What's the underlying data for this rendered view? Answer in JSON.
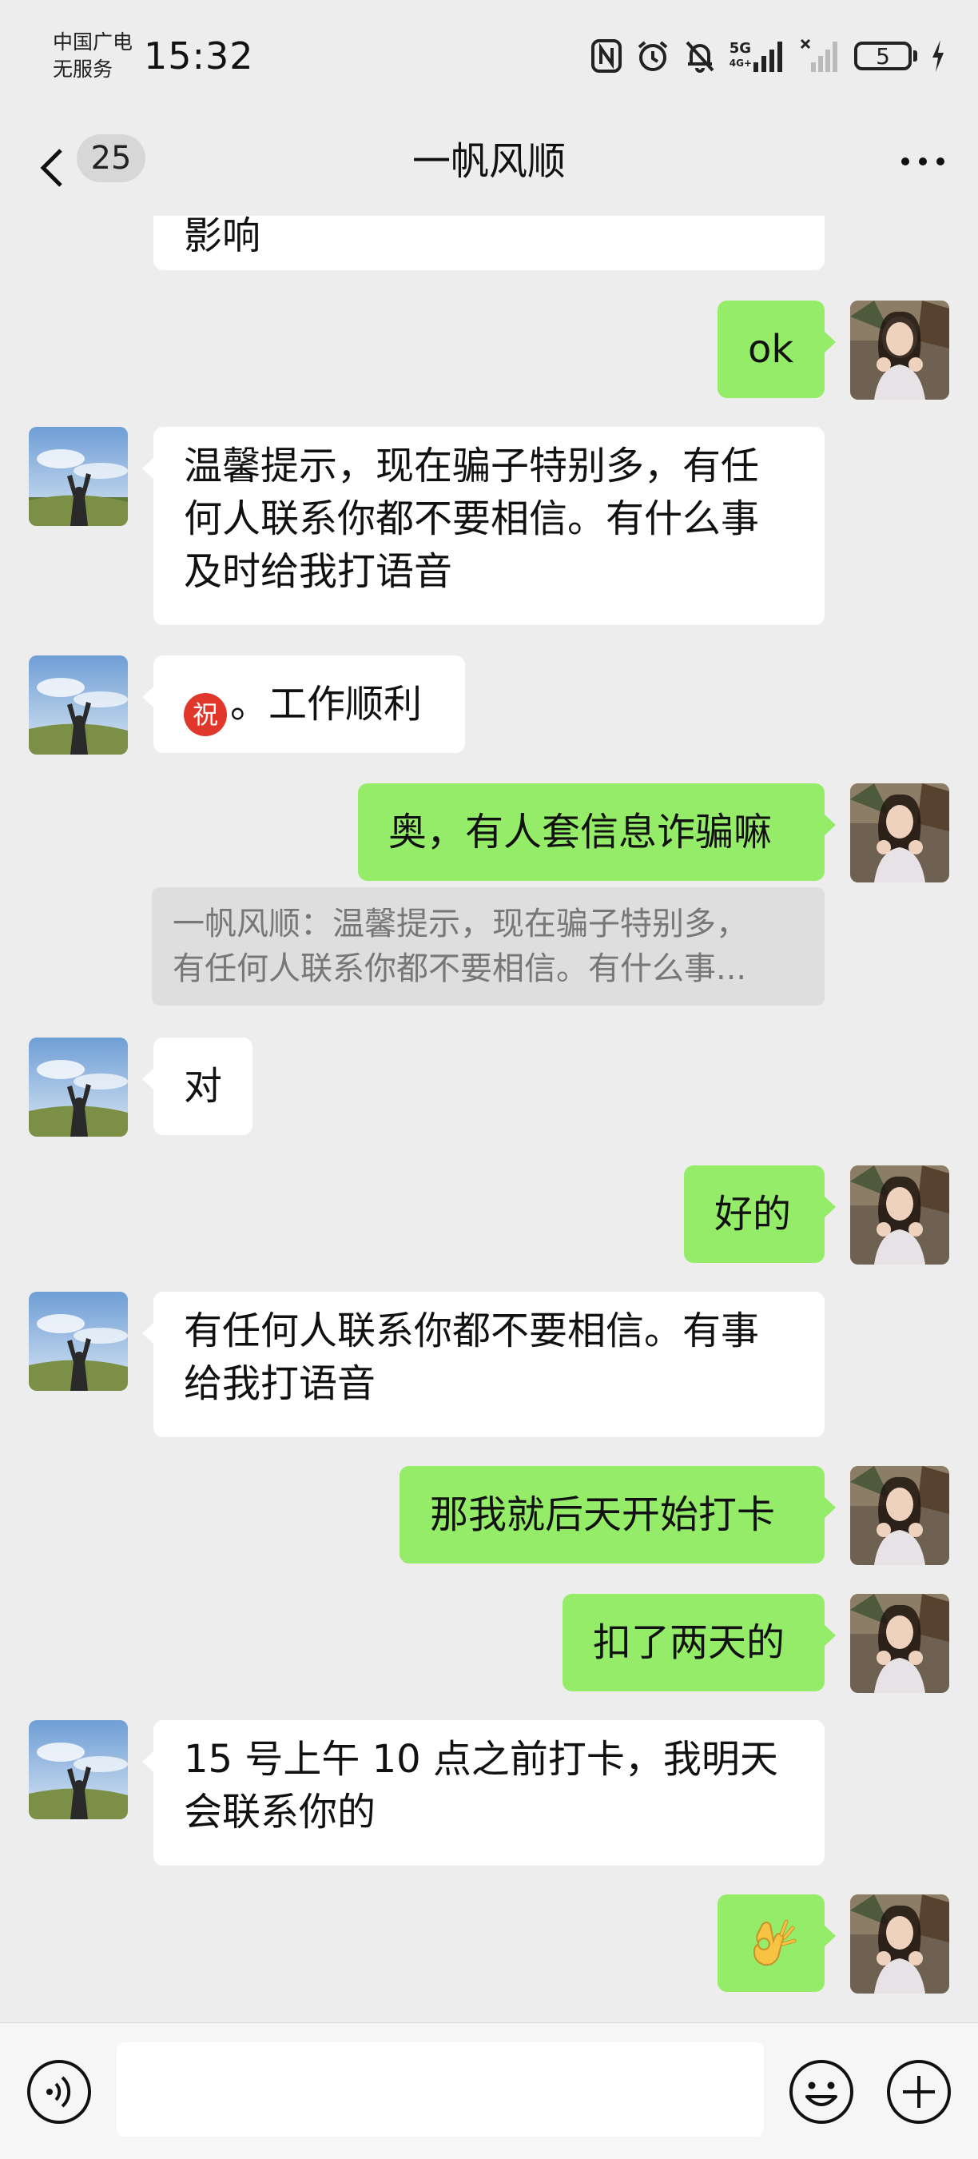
{
  "status_bar": {
    "carrier_line1": "中国广电",
    "carrier_line2": "无服务",
    "time": "15:32",
    "network": "5G",
    "battery": "5"
  },
  "header": {
    "unread_count": "25",
    "title": "一帆风顺"
  },
  "messages": [
    {
      "side": "in",
      "text": "影响",
      "partial": true
    },
    {
      "side": "out",
      "text": "ok"
    },
    {
      "side": "in",
      "lines": [
        "温馨提示，现在骗子特别多，有任",
        "何人联系你都不要相信。有什么事",
        "及时给我打语音"
      ]
    },
    {
      "side": "in",
      "emoji": "祝",
      "text": "。工作顺利"
    },
    {
      "side": "out",
      "text": "奥，有人套信息诈骗嘛"
    },
    {
      "side": "in",
      "text": "对"
    },
    {
      "side": "out",
      "text": "好的"
    },
    {
      "side": "in",
      "lines": [
        "有任何人联系你都不要相信。有事",
        "给我打语音"
      ]
    },
    {
      "side": "out",
      "text": "那我就后天开始打卡"
    },
    {
      "side": "out",
      "text": "扣了两天的"
    },
    {
      "side": "in",
      "lines": [
        "15 号上午 10 点之前打卡，我明天",
        "会联系你的"
      ]
    },
    {
      "side": "out",
      "emoji_name": "ok-hand-emoji"
    }
  ],
  "quote": {
    "line1": "一帆风顺：温馨提示，现在骗子特别多，",
    "line2": "有任何人联系你都不要相信。有什么事..."
  },
  "input_bar": {
    "placeholder": ""
  },
  "colors": {
    "background": "#ededed",
    "outgoing_bubble": "#95ec69",
    "incoming_bubble": "#ffffff"
  }
}
